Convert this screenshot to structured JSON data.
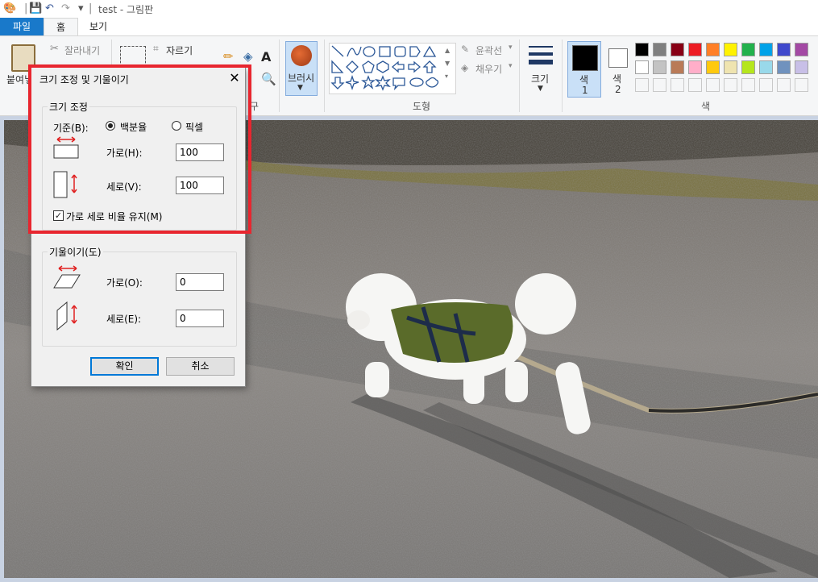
{
  "window": {
    "title": "test - 그림판"
  },
  "tabs": {
    "file": "파일",
    "home": "홈",
    "view": "보기"
  },
  "ribbon": {
    "clipboard": {
      "paste": "붙여넣",
      "cut": "잘라내기"
    },
    "image": {
      "crop": "자르기"
    },
    "tools_group_tail": "구",
    "brush": "브러시",
    "shapes": {
      "outline": "윤곽선",
      "fill": "채우기",
      "group_label": "도형"
    },
    "size": "크기",
    "color1": {
      "label": "색",
      "num": "1"
    },
    "color2": {
      "label": "색",
      "num": "2"
    },
    "colors_group_label": "색",
    "palette_row1": [
      "#000000",
      "#7f7f7f",
      "#880015",
      "#ed1c24",
      "#ff7f27",
      "#fff200",
      "#22b14c",
      "#00a2e8",
      "#3f48cc",
      "#a349a4"
    ],
    "palette_row2": [
      "#ffffff",
      "#c3c3c3",
      "#b97a57",
      "#ffaec9",
      "#ffc90e",
      "#efe4b0",
      "#b5e61d",
      "#99d9ea",
      "#7092be",
      "#c8bfe7"
    ]
  },
  "dialog": {
    "title": "크기 조정 및 기울이기",
    "resize": {
      "legend": "크기 조정",
      "basis_label": "기준(B):",
      "option_percent": "백분율",
      "option_pixel": "픽셀",
      "selected": "percent",
      "horizontal_label": "가로(H):",
      "horizontal_value": "100",
      "vertical_label": "세로(V):",
      "vertical_value": "100",
      "keep_ratio_label": "가로 세로 비율 유지(M)",
      "keep_ratio_checked": true
    },
    "skew": {
      "legend": "기울이기(도)",
      "horizontal_label": "가로(O):",
      "horizontal_value": "0",
      "vertical_label": "세로(E):",
      "vertical_value": "0"
    },
    "ok": "확인",
    "cancel": "취소"
  },
  "colors": {
    "accent": "#1979ca",
    "highlight": "#e8262f"
  }
}
